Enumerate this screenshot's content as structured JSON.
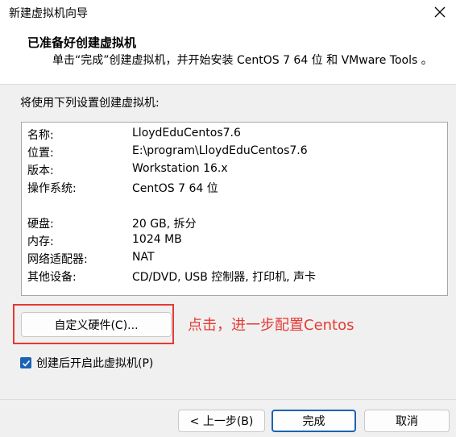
{
  "window": {
    "title": "新建虚拟机向导"
  },
  "header": {
    "title": "已准备好创建虚拟机",
    "subtitle": "单击“完成”创建虚拟机，并开始安装 CentOS 7 64 位 和 VMware Tools 。"
  },
  "intro": "将使用下列设置创建虚拟机:",
  "settings": [
    {
      "key": "名称:",
      "value": "LloydEduCentos7.6"
    },
    {
      "key": "位置:",
      "value": "E:\\program\\LloydEduCentos7.6"
    },
    {
      "key": "版本:",
      "value": "Workstation 16.x"
    },
    {
      "key": "操作系统:",
      "value": "CentOS 7 64 位"
    },
    {
      "key": "硬盘:",
      "value": "20 GB, 拆分"
    },
    {
      "key": "内存:",
      "value": "1024 MB"
    },
    {
      "key": "网络适配器:",
      "value": "NAT"
    },
    {
      "key": "其他设备:",
      "value": "CD/DVD, USB 控制器, 打印机, 声卡"
    }
  ],
  "customize_button": "自定义硬件(C)...",
  "annotation": "点击，进一步配置Centos",
  "power_on": {
    "label": "创建后开启此虚拟机(P)",
    "checked": true
  },
  "footer": {
    "back": "< 上一步(B)",
    "finish": "完成",
    "cancel": "取消"
  },
  "colors": {
    "accent": "#1a63b3",
    "annotation": "#e53935"
  },
  "icons": {
    "close": "close-icon",
    "check": "checkmark-icon"
  }
}
